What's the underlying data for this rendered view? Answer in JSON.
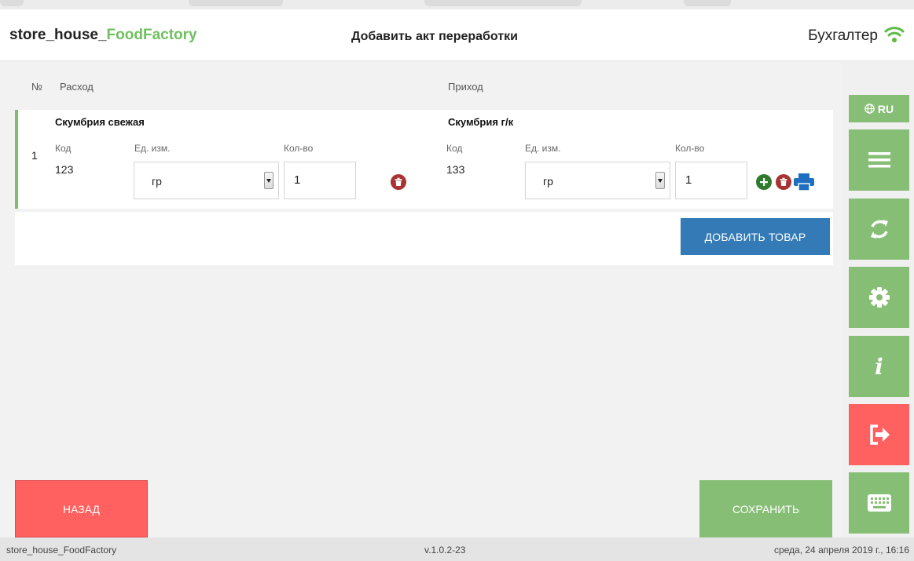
{
  "header": {
    "app_name_prefix": "store_house_",
    "app_name_accent": "FoodFactory",
    "page_title": "Добавить акт переработки",
    "user": "Бухгалтер",
    "accent_color": "#6fbf5f"
  },
  "table": {
    "headers": {
      "num": "№",
      "expense": "Расход",
      "income": "Приход"
    },
    "rows": [
      {
        "num": "1",
        "expense": {
          "name": "Скумбрия свежая",
          "code_label": "Код",
          "code": "123",
          "unit_label": "Ед. изм.",
          "unit": "гр",
          "qty_label": "Кол-во",
          "qty": "1"
        },
        "income": {
          "name": "Скумбрия г/к",
          "code_label": "Код",
          "code": "133",
          "unit_label": "Ед. изм.",
          "unit": "гр",
          "qty_label": "Кол-во",
          "qty": "1"
        }
      }
    ]
  },
  "actions": {
    "add_item": "ДОБАВИТЬ ТОВАР",
    "back": "НАЗАД",
    "save": "СОХРАНИТЬ"
  },
  "sidebar": {
    "lang": "RU",
    "items": [
      "menu-icon",
      "sync-icon",
      "gear-icon",
      "info-icon",
      "logout-icon",
      "keyboard-icon"
    ]
  },
  "footer": {
    "app": "store_house_FoodFactory",
    "version": "v.1.0.2-23",
    "datetime": "среда, 24 апреля 2019 г., 16:16"
  },
  "colors": {
    "green": "#87be75",
    "red": "#ff6060",
    "blue": "#337ab7",
    "trash": "#a93232"
  }
}
